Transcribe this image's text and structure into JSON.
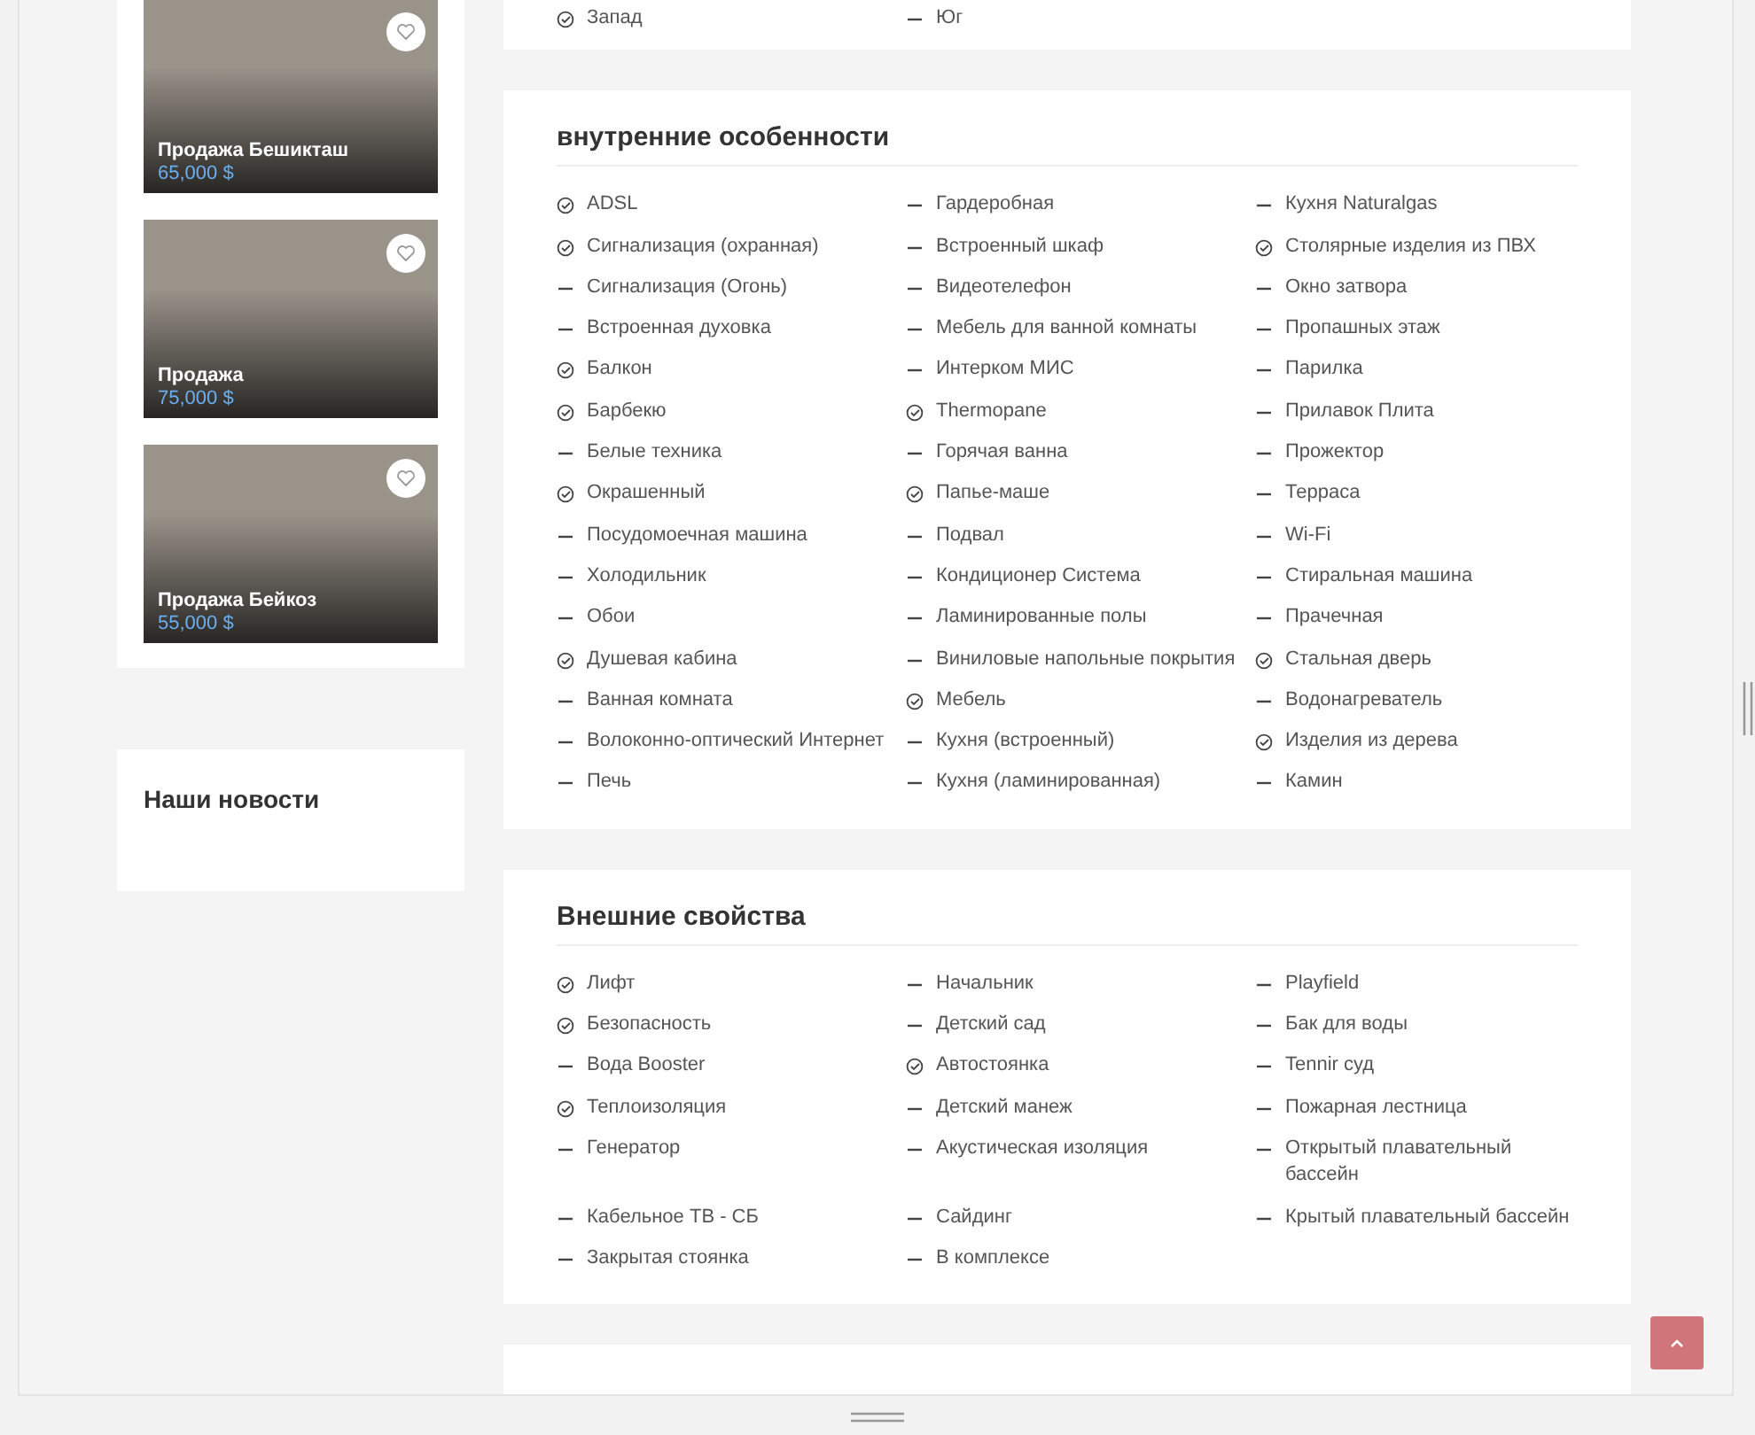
{
  "listings": [
    {
      "title": "Продажа Бешикташ",
      "price": "65,000 $"
    },
    {
      "title": "Продажа",
      "price": "75,000 $"
    },
    {
      "title": "Продажа Бейкоз",
      "price": "55,000 $"
    }
  ],
  "news": {
    "title": "Наши новости"
  },
  "direction": {
    "items": [
      {
        "label": "Запад",
        "checked": true
      },
      {
        "label": "Юг",
        "checked": false
      }
    ]
  },
  "sections": [
    {
      "title": "внутренние особенности",
      "items": [
        {
          "label": "ADSL",
          "checked": true
        },
        {
          "label": "Гардеробная",
          "checked": false
        },
        {
          "label": "Кухня Naturalgas",
          "checked": false
        },
        {
          "label": "Сигнализация (охранная)",
          "checked": true
        },
        {
          "label": "Встроенный шкаф",
          "checked": false
        },
        {
          "label": "Столярные изделия из ПВХ",
          "checked": true
        },
        {
          "label": "Сигнализация (Огонь)",
          "checked": false
        },
        {
          "label": "Видеотелефон",
          "checked": false
        },
        {
          "label": "Окно затвора",
          "checked": false
        },
        {
          "label": "Встроенная духовка",
          "checked": false
        },
        {
          "label": "Мебель для ванной комнаты",
          "checked": false
        },
        {
          "label": "Пропашных этаж",
          "checked": false
        },
        {
          "label": "Балкон",
          "checked": true
        },
        {
          "label": "Интерком МИС",
          "checked": false
        },
        {
          "label": "Парилка",
          "checked": false
        },
        {
          "label": "Барбекю",
          "checked": true
        },
        {
          "label": "Thermopane",
          "checked": true
        },
        {
          "label": "Прилавок Плита",
          "checked": false
        },
        {
          "label": "Белые техника",
          "checked": false
        },
        {
          "label": "Горячая ванна",
          "checked": false
        },
        {
          "label": "Прожектор",
          "checked": false
        },
        {
          "label": "Окрашенный",
          "checked": true
        },
        {
          "label": "Папье-маше",
          "checked": true
        },
        {
          "label": "Терраса",
          "checked": false
        },
        {
          "label": "Посудомоечная машина",
          "checked": false
        },
        {
          "label": "Подвал",
          "checked": false
        },
        {
          "label": "Wi-Fi",
          "checked": false
        },
        {
          "label": "Холодильник",
          "checked": false
        },
        {
          "label": "Кондиционер Система",
          "checked": false
        },
        {
          "label": "Стиральная машина",
          "checked": false
        },
        {
          "label": "Обои",
          "checked": false
        },
        {
          "label": "Ламинированные полы",
          "checked": false
        },
        {
          "label": "Прачечная",
          "checked": false
        },
        {
          "label": "Душевая кабина",
          "checked": true
        },
        {
          "label": "Виниловые напольные покрытия",
          "checked": false
        },
        {
          "label": "Стальная дверь",
          "checked": true
        },
        {
          "label": "Ванная комната",
          "checked": false
        },
        {
          "label": "Мебель",
          "checked": true
        },
        {
          "label": "Водонагреватель",
          "checked": false
        },
        {
          "label": "Волоконно-оптический Интернет",
          "checked": false
        },
        {
          "label": "Кухня (встроенный)",
          "checked": false
        },
        {
          "label": "Изделия из дерева",
          "checked": true
        },
        {
          "label": "Печь",
          "checked": false
        },
        {
          "label": "Кухня (ламинированная)",
          "checked": false
        },
        {
          "label": "Камин",
          "checked": false
        }
      ]
    },
    {
      "title": "Внешние свойства",
      "items": [
        {
          "label": "Лифт",
          "checked": true
        },
        {
          "label": "Начальник",
          "checked": false
        },
        {
          "label": "Playfield",
          "checked": false
        },
        {
          "label": "Безопасность",
          "checked": true
        },
        {
          "label": "Детский сад",
          "checked": false
        },
        {
          "label": "Бак для воды",
          "checked": false
        },
        {
          "label": "Вода Booster",
          "checked": false
        },
        {
          "label": "Автостоянка",
          "checked": true
        },
        {
          "label": "Tennir суд",
          "checked": false
        },
        {
          "label": "Теплоизоляция",
          "checked": true
        },
        {
          "label": "Детский манеж",
          "checked": false
        },
        {
          "label": "Пожарная лестница",
          "checked": false
        },
        {
          "label": "Генератор",
          "checked": false
        },
        {
          "label": "Акустическая изоляция",
          "checked": false
        },
        {
          "label": "Открытый плавательный бассейн",
          "checked": false
        },
        {
          "label": "Кабельное ТВ - СБ",
          "checked": false
        },
        {
          "label": "Сайдинг",
          "checked": false
        },
        {
          "label": "Крытый плавательный бассейн",
          "checked": false
        },
        {
          "label": "Закрытая стоянка",
          "checked": false
        },
        {
          "label": "В комплексе",
          "checked": false
        }
      ]
    }
  ]
}
